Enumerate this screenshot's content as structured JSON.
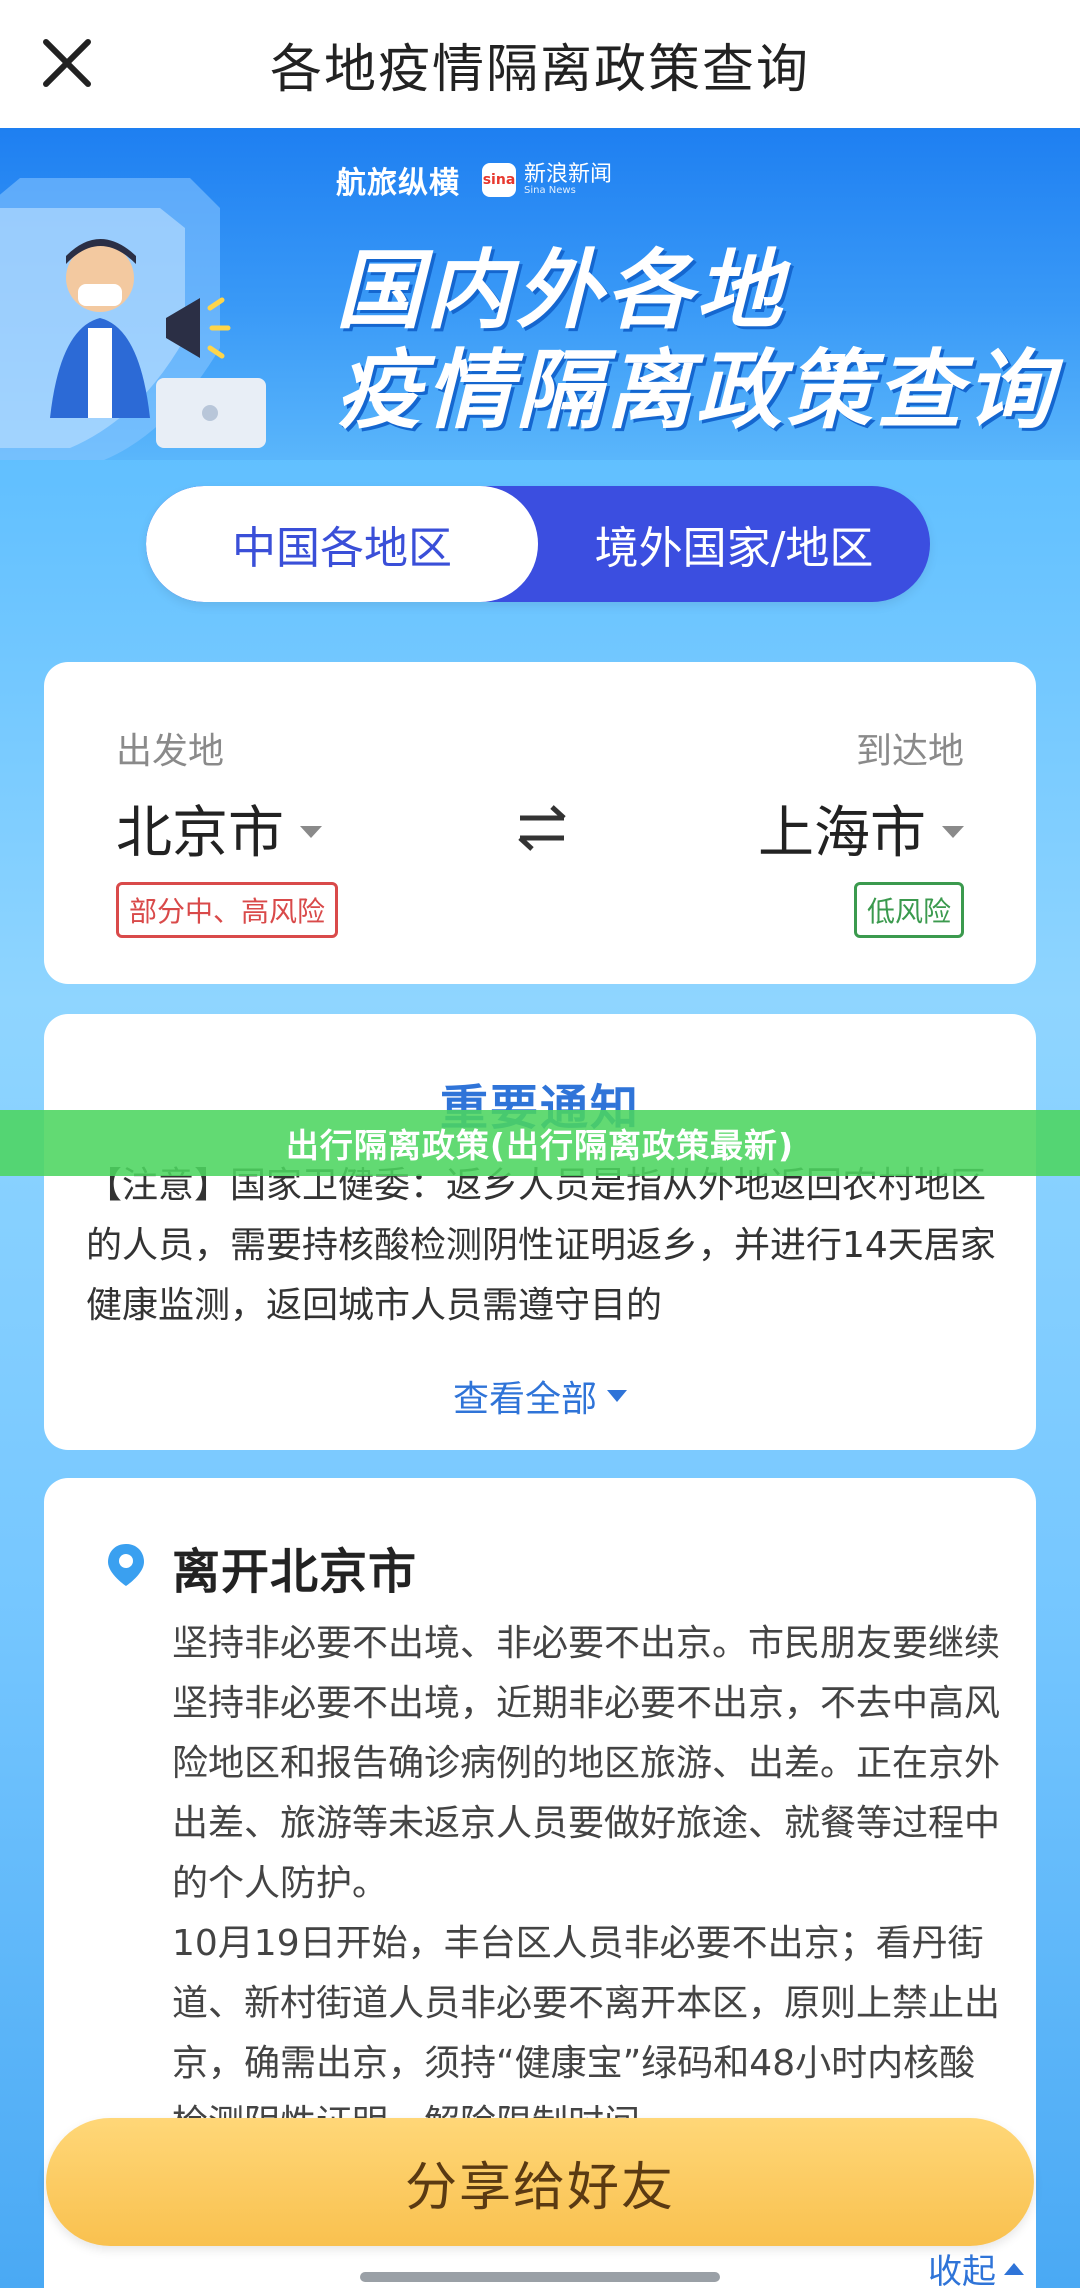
{
  "topbar": {
    "title": "各地疫情隔离政策查询",
    "close_icon": "close-icon"
  },
  "banner": {
    "brand_a": "航旅纵横",
    "brand_b_logo": "sina",
    "brand_b_cn": "新浪新闻",
    "brand_b_en": "Sina News",
    "heading_line1": "国内外各地",
    "heading_line2": "疫情隔离政策查询"
  },
  "tabs": [
    {
      "label": "中国各地区",
      "active": true
    },
    {
      "label": "境外国家/地区",
      "active": false
    }
  ],
  "route": {
    "from_label": "出发地",
    "to_label": "到达地",
    "from_city": "北京市",
    "to_city": "上海市",
    "from_risk": "部分中、高风险",
    "to_risk": "低风险",
    "swap_icon": "swap-arrows-icon"
  },
  "notice": {
    "title": "重要通知",
    "text": "【注意】国家卫健委：返乡人员是指从外地返回农村地区的人员，需要持核酸检测阴性证明返乡，并进行14天居家健康监测，返回城市人员需遵守目的",
    "more_label": "查看全部"
  },
  "overlay": {
    "caption": "出行隔离政策(出行隔离政策最新)"
  },
  "leave": {
    "title": "离开北京市",
    "paragraphs": [
      "坚持非必要不出境、非必要不出京。市民朋友要继续坚持非必要不出境，近期非必要不出京，不去中高风险地区和报告确诊病例的地区旅游、出差。正在京外出差、旅游等未返京人员要做好旅途、就餐等过程中的个人防护。",
      "10月19日开始，丰台区人员非必要不出京；看丹街道、新村街道人员非必要不离开本区，原则上禁止出京，确需出京，须持“健康宝”绿码和48小时内核酸检测阴性证明，解除限制时间"
    ]
  },
  "share_button": "分享给好友",
  "collapse_label": "收起",
  "colors": {
    "accent_blue": "#3b4ee0",
    "link_blue": "#2f74d8",
    "high_risk": "#d94a4a",
    "low_risk": "#3b9a4e",
    "share_yellow": "#f9c14f",
    "overlay_green": "#4cd560"
  }
}
